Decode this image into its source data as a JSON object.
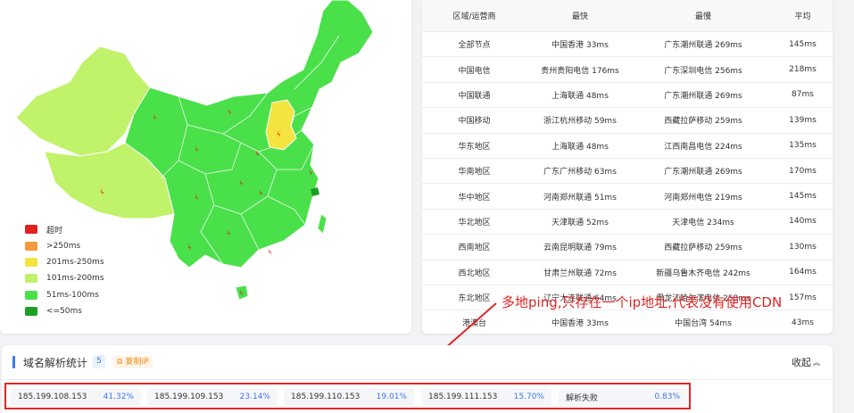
{
  "legend": [
    {
      "label": "超时",
      "color": "#e12020"
    },
    {
      "label": ">250ms",
      "color": "#f5983a"
    },
    {
      "label": "201ms-250ms",
      "color": "#f3e43f"
    },
    {
      "label": "101ms-200ms",
      "color": "#c0f26a"
    },
    {
      "label": "51ms-100ms",
      "color": "#4ae04a"
    },
    {
      "label": "<=50ms",
      "color": "#1f9e24"
    }
  ],
  "table": {
    "headers": [
      "区域/运营商",
      "最快",
      "最慢",
      "平均"
    ],
    "rows": [
      [
        "全部节点",
        "中国香港 33ms",
        "广东潮州联通 269ms",
        "145ms"
      ],
      [
        "中国电信",
        "贵州贵阳电信 176ms",
        "广东深圳电信 256ms",
        "218ms"
      ],
      [
        "中国联通",
        "上海联通 48ms",
        "广东潮州联通 269ms",
        "87ms"
      ],
      [
        "中国移动",
        "浙江杭州移动 59ms",
        "西藏拉萨移动 259ms",
        "139ms"
      ],
      [
        "华东地区",
        "上海联通 48ms",
        "江西南昌电信 224ms",
        "135ms"
      ],
      [
        "华南地区",
        "广东广州移动 63ms",
        "广东潮州联通 269ms",
        "170ms"
      ],
      [
        "华中地区",
        "河南郑州联通 51ms",
        "河南郑州电信 219ms",
        "145ms"
      ],
      [
        "华北地区",
        "天津联通 52ms",
        "天津电信 234ms",
        "140ms"
      ],
      [
        "西南地区",
        "云南昆明联通 79ms",
        "西藏拉萨移动 259ms",
        "130ms"
      ],
      [
        "西北地区",
        "甘肃兰州联通 72ms",
        "新疆乌鲁木齐电信 242ms",
        "164ms"
      ],
      [
        "东北地区",
        "辽宁大连联通 64ms",
        "黑龙江哈尔滨电信 253ms",
        "157ms"
      ],
      [
        "港澳台",
        "中国香港 33ms",
        "中国台湾 54ms",
        "43ms"
      ]
    ]
  },
  "annotation": "多地ping,只存在一个ip地址,代表没有使用CDN",
  "dns": {
    "title": "域名解析统计",
    "count": "5",
    "copy_label": "复制IP",
    "collapse_label": "收起",
    "ips": [
      {
        "ip": "185.199.108.153",
        "pct": "41.32%"
      },
      {
        "ip": "185.199.109.153",
        "pct": "23.14%"
      },
      {
        "ip": "185.199.110.153",
        "pct": "19.01%"
      },
      {
        "ip": "185.199.111.153",
        "pct": "15.70%"
      },
      {
        "ip": "解析失败",
        "pct": "0.83%"
      }
    ]
  }
}
